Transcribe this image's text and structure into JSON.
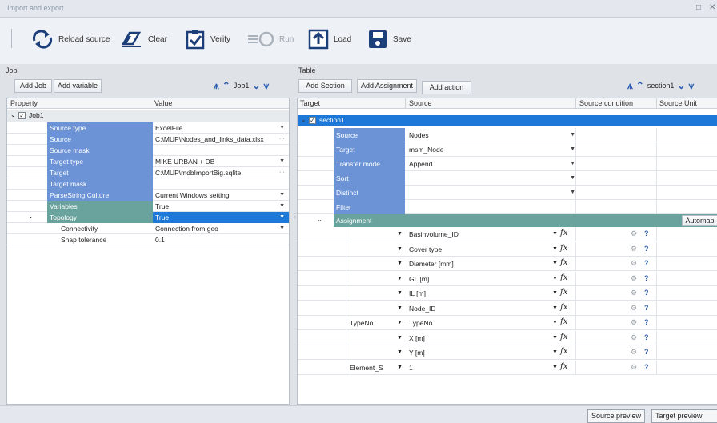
{
  "window": {
    "title": "Import and export",
    "restore": "□",
    "close": "✕"
  },
  "toolbar": {
    "reload": "Reload source",
    "clear": "Clear",
    "verify": "Verify",
    "run": "Run",
    "load": "Load",
    "save": "Save"
  },
  "job": {
    "section": "Job",
    "add_job": "Add Job",
    "add_variable": "Add variable",
    "nav_label": "Job1",
    "col_property": "Property",
    "col_value": "Value",
    "root": "Job1",
    "rows": [
      {
        "name": "Source type",
        "value": "ExcelFile",
        "ctl": "dd"
      },
      {
        "name": "Source",
        "value": "C:\\MUP\\Nodes_and_links_data.xlsx",
        "ctl": "ellipsis"
      },
      {
        "name": "Source mask",
        "value": "",
        "ctl": ""
      },
      {
        "name": "Target type",
        "value": "MIKE URBAN + DB",
        "ctl": "dd"
      },
      {
        "name": "Target",
        "value": "C:\\MUP\\mdbImportBig.sqlite",
        "ctl": "ellipsis"
      },
      {
        "name": "Target mask",
        "value": "",
        "ctl": ""
      },
      {
        "name": "ParseString Culture",
        "value": "Current Windows setting",
        "ctl": "dd"
      },
      {
        "name": "Variables",
        "value": "True",
        "ctl": "dd"
      },
      {
        "name": "Topology",
        "value": "True",
        "ctl": "dd"
      }
    ],
    "sub": [
      {
        "name": "Connectivity",
        "value": "Connection from geo"
      },
      {
        "name": "Snap tolerance",
        "value": "0.1"
      }
    ]
  },
  "table": {
    "section": "Table",
    "add_section": "Add Section",
    "add_assignment": "Add Assignment",
    "add_action": "Add action",
    "nav_label": "section1",
    "cols": {
      "target": "Target",
      "source": "Source",
      "cond": "Source condition",
      "unit": "Source Unit"
    },
    "root": "section1",
    "props": [
      {
        "name": "Source",
        "value": "Nodes",
        "dd": true
      },
      {
        "name": "Target",
        "value": "msm_Node",
        "dd": true
      },
      {
        "name": "Transfer mode",
        "value": "Append",
        "dd": true
      },
      {
        "name": "Sort",
        "value": "",
        "dd": true
      },
      {
        "name": "Distinct",
        "value": "",
        "dd": true
      },
      {
        "name": "Filter",
        "value": "",
        "dd": false
      }
    ],
    "assignment": "Assignment",
    "automap": "Automap",
    "assign_rows": [
      {
        "target": "",
        "source": "Basinvolume_ID"
      },
      {
        "target": "",
        "source": "Cover type"
      },
      {
        "target": "",
        "source": "Diameter [mm]"
      },
      {
        "target": "",
        "source": "GL [m]"
      },
      {
        "target": "",
        "source": "IL [m]"
      },
      {
        "target": "",
        "source": "Node_ID"
      },
      {
        "target": "TypeNo",
        "source": "TypeNo"
      },
      {
        "target": "",
        "source": "X [m]"
      },
      {
        "target": "",
        "source": "Y [m]"
      },
      {
        "target": "Element_S",
        "source": "1"
      }
    ],
    "fx": "fx",
    "gear": "⚙",
    "q": "?"
  },
  "status": {
    "source_preview": "Source preview",
    "target_preview": "Target preview"
  }
}
